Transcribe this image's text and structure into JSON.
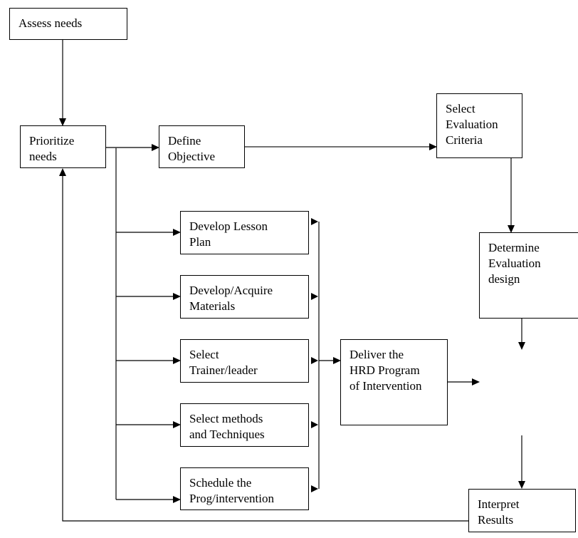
{
  "diagram": {
    "nodes": {
      "assess_needs": "Assess needs",
      "prioritize_needs": "Prioritize\nneeds",
      "define_objective": "Define\nObjective",
      "select_evaluation_criteria": "Select\nEvaluation\nCriteria",
      "determine_evaluation_design": "Determine\nEvaluation\ndesign",
      "develop_lesson_plan": "Develop Lesson\nPlan",
      "develop_acquire_materials": "Develop/Acquire\nMaterials",
      "select_trainer_leader": "Select\nTrainer/leader",
      "select_methods_techniques": "Select methods\nand Techniques",
      "schedule_program": "Schedule the\nProg/intervention",
      "deliver_hrd_program": "Deliver the\nHRD Program\nof Intervention",
      "interpret_results": "Interpret\nResults"
    },
    "edges": [
      {
        "from": "assess_needs",
        "to": "prioritize_needs"
      },
      {
        "from": "prioritize_needs",
        "to": "define_objective"
      },
      {
        "from": "define_objective",
        "to": "select_evaluation_criteria"
      },
      {
        "from": "select_evaluation_criteria",
        "to": "determine_evaluation_design"
      },
      {
        "from": "prioritize_needs",
        "to": "develop_lesson_plan"
      },
      {
        "from": "prioritize_needs",
        "to": "develop_acquire_materials"
      },
      {
        "from": "prioritize_needs",
        "to": "select_trainer_leader"
      },
      {
        "from": "prioritize_needs",
        "to": "select_methods_techniques"
      },
      {
        "from": "prioritize_needs",
        "to": "schedule_program"
      },
      {
        "from": "develop_lesson_plan",
        "to": "deliver_hrd_program"
      },
      {
        "from": "develop_acquire_materials",
        "to": "deliver_hrd_program"
      },
      {
        "from": "select_trainer_leader",
        "to": "deliver_hrd_program"
      },
      {
        "from": "select_methods_techniques",
        "to": "deliver_hrd_program"
      },
      {
        "from": "schedule_program",
        "to": "deliver_hrd_program"
      },
      {
        "from": "deliver_hrd_program",
        "to": "(blank area)"
      },
      {
        "from": "determine_evaluation_design",
        "to": "(blank area)"
      },
      {
        "from": "(blank area)",
        "to": "interpret_results"
      },
      {
        "from": "interpret_results",
        "to": "prioritize_needs"
      }
    ]
  }
}
